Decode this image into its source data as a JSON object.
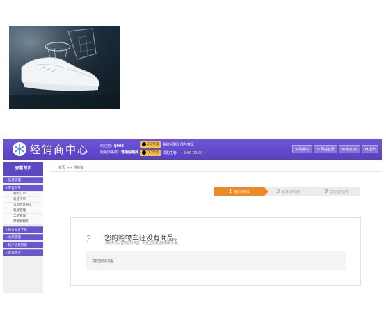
{
  "photo": {
    "icon": "sneaker-photo"
  },
  "header": {
    "logo_icon": "snowflake-logo-icon",
    "logo_text": "经销商中心",
    "welcome_label": "欢迎您：",
    "welcome_value": "lj002",
    "level_label": "经销商等级：",
    "level_value": "普通经销商",
    "services": [
      {
        "badge": "QQ交谈",
        "label": "系统问题反馈与意见",
        "value": ""
      },
      {
        "badge": "QQ交谈",
        "label": "采购主管——",
        "value": "8:00-22:00"
      }
    ],
    "buttons": [
      {
        "icon": "cart-icon",
        "glyph": "⊞",
        "label": "购物车"
      },
      {
        "icon": "home-icon",
        "glyph": "⌂",
        "label": "网站首页"
      },
      {
        "icon": "message-icon",
        "glyph": "✉",
        "label": "消息(0)"
      },
      {
        "icon": "logout-icon",
        "glyph": "⚙",
        "label": "退出"
      }
    ]
  },
  "sidebar": {
    "home": "查看首页",
    "categories": [
      {
        "label": "▸ 信息管理"
      },
      {
        "label": "▾ 零售下单"
      }
    ],
    "subitems": [
      {
        "label": "我的订单"
      },
      {
        "label": "商品下单"
      },
      {
        "label": "订单批量导入"
      },
      {
        "label": "看品管理"
      },
      {
        "label": "工单管理"
      },
      {
        "label": "零售购物车"
      }
    ],
    "bottom_categories": [
      {
        "label": "▸ 特价批发下单"
      },
      {
        "label": "▸ 仓库管理"
      },
      {
        "label": "▸ 账户信息管理"
      },
      {
        "label": "▸ 提现购买"
      }
    ]
  },
  "main": {
    "breadcrumb_home": "首页",
    "breadcrumb_sep": ">>",
    "breadcrumb_current": "购物车",
    "steps": [
      {
        "num": "1",
        "label": "我的购物车"
      },
      {
        "num": "2",
        "label": "核对订单信息"
      },
      {
        "num": "3",
        "label": "成功提交订单"
      }
    ],
    "empty_icon": "?",
    "empty_title": "您的购物车还没有商品。",
    "empty_sub": "购物车可以暂存您的商品，并且显示商品的最新价格。",
    "favorites_label": "去我选购的商品"
  },
  "colors": {
    "header": "#5a3fc4",
    "sidebar_cat": "#6a55d0",
    "step_active": "#f08a1e"
  }
}
